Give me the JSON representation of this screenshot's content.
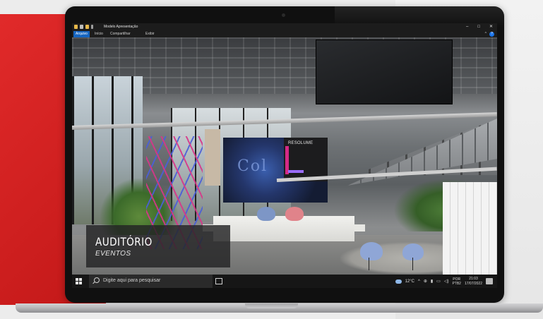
{
  "explorer": {
    "title": "Modelo Apresentação",
    "ribbon_tabs": [
      "Arquivo",
      "Início",
      "Compartilhar",
      "Exibir"
    ],
    "window_controls": [
      "–",
      "□",
      "✕"
    ],
    "help": "?"
  },
  "slide": {
    "sign_text": "RESOLUME",
    "led_art_text": "Col",
    "caption_title": "AUDITÓRIO",
    "caption_subtitle": "EVENTOS"
  },
  "taskbar": {
    "search_placeholder": "Digite aqui para pesquisar",
    "temperature": "12°C",
    "lang_top": "POR",
    "lang_bottom": "PTB2",
    "time": "21:03",
    "date": "17/07/2022",
    "tray_chevron": "^"
  },
  "colors": {
    "brand_red": "#d42020",
    "ribbon_active": "#1565c0"
  }
}
